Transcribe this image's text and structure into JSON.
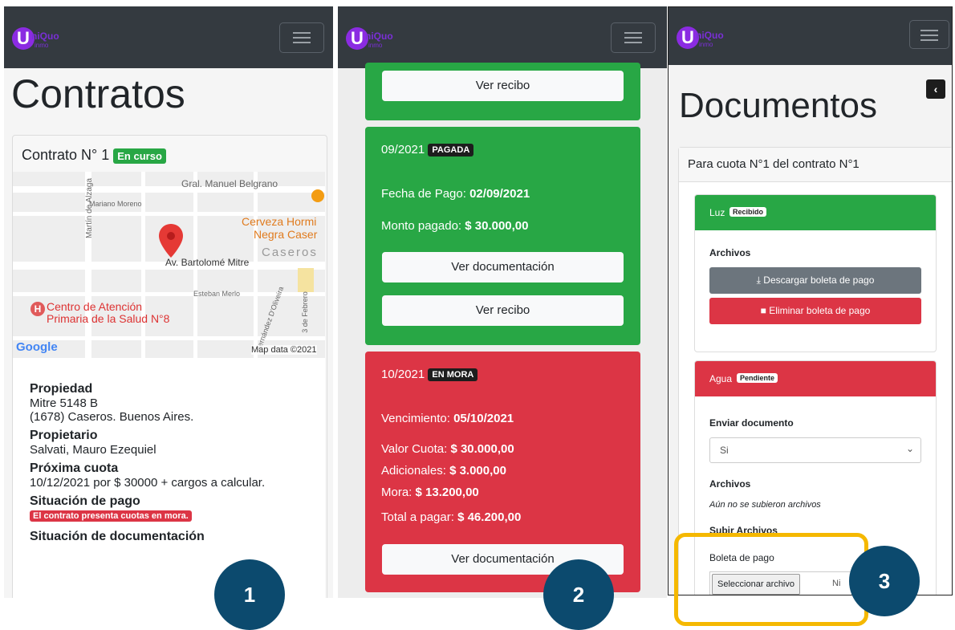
{
  "brand": {
    "logo_letter": "U",
    "logo_name": "niQuo",
    "logo_sub": "inmo"
  },
  "panel1": {
    "title": "Contratos",
    "contract_heading": "Contrato N° 1",
    "contract_status": "En curso",
    "map": {
      "streets": [
        "Gral. Manuel Belgrano",
        "Mariano Moreno",
        "Martín de Alzaga",
        "Av. Bartolomé Mitre",
        "Esteban Merlo",
        "Fernández D'Oliveira",
        "3 de Febrero"
      ],
      "places": [
        "Cerveza Hormi",
        "Negra Caser",
        "Caseros",
        "Centro de Atención",
        "Primaria de la Salud N°8"
      ],
      "google": "Google",
      "attribution": "Map data ©2021"
    },
    "property_label": "Propiedad",
    "property_line1": "Mitre 5148 B",
    "property_line2": "(1678) Caseros. Buenos Aires.",
    "owner_label": "Propietario",
    "owner_value": "Salvati, Mauro Ezequiel",
    "next_label": "Próxima cuota",
    "next_value": "10/12/2021 por $ 30000 + cargos a calcular.",
    "payment_label": "Situación de pago",
    "payment_badge": "El contrato presenta cuotas en mora.",
    "doc_label": "Situación de documentación",
    "marker": "1"
  },
  "panel2": {
    "top_button": "Ver recibo",
    "paid_card": {
      "period": "09/2021",
      "badge": "PAGADA",
      "date_label": "Fecha de Pago:",
      "date_value": "02/09/2021",
      "amount_label": "Monto pagado:",
      "amount_value": "$ 30.000,00",
      "doc_button": "Ver documentación",
      "receipt_button": "Ver recibo"
    },
    "late_card": {
      "period": "10/2021",
      "badge": "EN MORA",
      "due_label": "Vencimiento:",
      "due_value": "05/10/2021",
      "fee_label": "Valor Cuota:",
      "fee_value": "$ 30.000,00",
      "extra_label": "Adicionales:",
      "extra_value": "$ 3.000,00",
      "late_label": "Mora:",
      "late_value": "$ 13.200,00",
      "total_label": "Total a pagar:",
      "total_value": "$ 46.200,00",
      "doc_button": "Ver documentación"
    },
    "marker": "2"
  },
  "panel3": {
    "title": "Documentos",
    "card_header": "Para cuota N°1 del contrato N°1",
    "luz": {
      "name": "Luz",
      "badge": "Recibido",
      "files_label": "Archivos",
      "download_button": "Descargar boleta de pago",
      "delete_button": "Eliminar boleta de pago"
    },
    "agua": {
      "name": "Agua",
      "badge": "Pendiente",
      "send_label": "Enviar documento",
      "send_value": "Si",
      "files_label": "Archivos",
      "no_files": "Aún no se subieron archivos",
      "upload_label": "Subir Archivos",
      "file_field_label": "Boleta de pago",
      "file_button": "Seleccionar archivo",
      "file_status": "Ni"
    },
    "marker": "3"
  },
  "colors": {
    "green": "#28a745",
    "red": "#dc3545",
    "navbar": "#343a40",
    "marker": "#0c4a6e",
    "highlight": "#f5b800"
  }
}
